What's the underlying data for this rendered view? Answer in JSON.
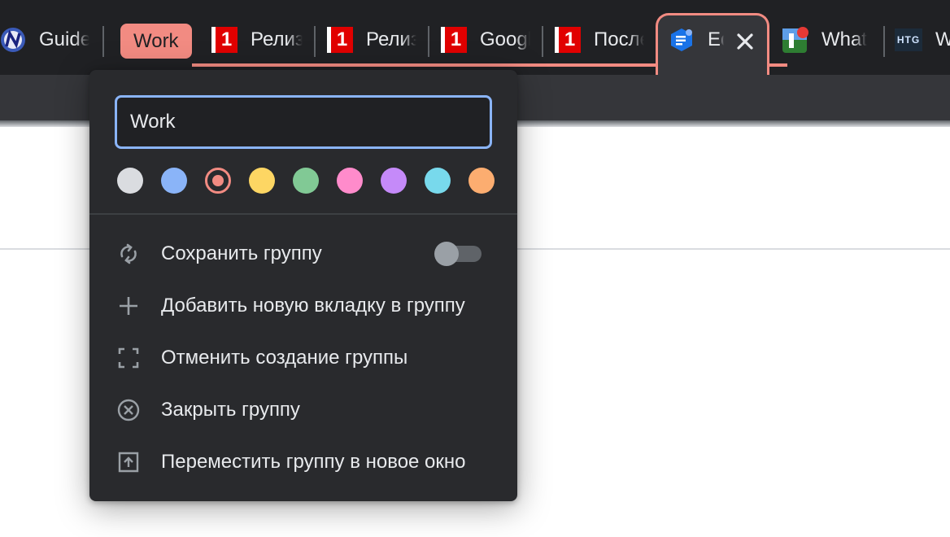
{
  "tabs": [
    {
      "title": "Guide",
      "favicon": "nightly-globe-icon"
    },
    {
      "title": "Релиз",
      "favicon": "channel-one-icon"
    },
    {
      "title": "Релиз",
      "favicon": "channel-one-icon"
    },
    {
      "title": "Google",
      "favicon": "channel-one-icon"
    },
    {
      "title": "После",
      "favicon": "channel-one-icon"
    },
    {
      "title": "Ed",
      "favicon": "document-badge-icon",
      "active": true
    },
    {
      "title": "What",
      "favicon": "notification-app-icon"
    },
    {
      "title": "W",
      "favicon": "htg-icon",
      "favicon_text": "HTG"
    }
  ],
  "group": {
    "name": "Work",
    "accent_color": "#f28b82"
  },
  "popup": {
    "name_value": "Work",
    "colors": [
      {
        "name": "grey",
        "hex": "#dadce0"
      },
      {
        "name": "blue",
        "hex": "#8ab4f8"
      },
      {
        "name": "red",
        "hex": "#f28b82",
        "selected": true
      },
      {
        "name": "yellow",
        "hex": "#fdd663"
      },
      {
        "name": "green",
        "hex": "#81c995"
      },
      {
        "name": "pink",
        "hex": "#ff8bcb"
      },
      {
        "name": "purple",
        "hex": "#c58af9"
      },
      {
        "name": "cyan",
        "hex": "#78d9ec"
      },
      {
        "name": "orange",
        "hex": "#fcad70"
      }
    ],
    "menu": [
      {
        "label": "Сохранить группу",
        "icon": "sync-icon",
        "toggle": false
      },
      {
        "label": "Добавить новую вкладку в группу",
        "icon": "plus-icon"
      },
      {
        "label": "Отменить создание группы",
        "icon": "ungroup-icon"
      },
      {
        "label": "Закрыть группу",
        "icon": "close-circle-icon"
      },
      {
        "label": "Переместить группу в новое окно",
        "icon": "move-window-icon"
      }
    ]
  }
}
